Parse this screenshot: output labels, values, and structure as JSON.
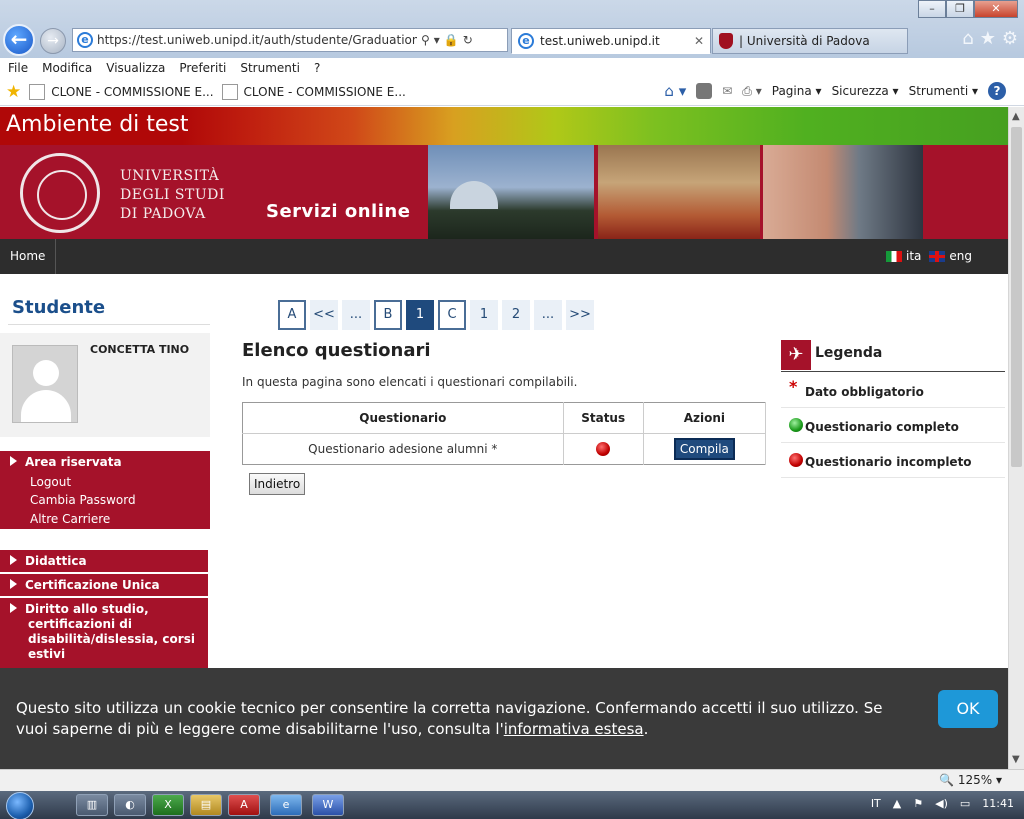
{
  "browser": {
    "url": "https://test.uniweb.unipd.it/auth/studente/Graduation/SceltaC",
    "tabs": [
      {
        "label": "test.uniweb.unipd.it"
      },
      {
        "label": "| Università di Padova"
      }
    ],
    "menu": [
      "File",
      "Modifica",
      "Visualizza",
      "Preferiti",
      "Strumenti",
      "?"
    ],
    "favorites": [
      "CLONE - COMMISSIONE E...",
      "CLONE - COMMISSIONE E..."
    ],
    "commands": [
      "Pagina",
      "Sicurezza",
      "Strumenti"
    ],
    "zoom": "125%"
  },
  "site": {
    "env_banner": "Ambiente di test",
    "uni_line1": "UNIVERSITÀ",
    "uni_line2": "DEGLI STUDI",
    "uni_line3": "DI PADOVA",
    "servizi": "Servizi online",
    "nav_home": "Home",
    "lang_it": "ita",
    "lang_en": "eng"
  },
  "sidebar": {
    "title": "Studente",
    "user_name": "CONCETTA TINO",
    "area_head": "Area riservata",
    "area_items": [
      "Logout",
      "Cambia Password",
      "Altre Carriere"
    ],
    "sections": [
      "Didattica",
      "Certificazione Unica",
      "Diritto allo studio, certificazioni di disabilità/dislessia, corsi estivi"
    ]
  },
  "pager": [
    "A",
    "<<",
    "...",
    "B",
    "1",
    "C",
    "1",
    "2",
    "...",
    ">>"
  ],
  "main": {
    "title": "Elenco questionari",
    "description": "In questa pagina sono elencati i questionari compilabili.",
    "table_headers": [
      "Questionario",
      "Status",
      "Azioni"
    ],
    "rows": [
      {
        "name": "Questionario adesione alumni *",
        "status": "incompleto",
        "action": "Compila"
      }
    ],
    "back_label": "Indietro"
  },
  "legend": {
    "title": "Legenda",
    "items": [
      "Dato obbligatorio",
      "Questionario completo",
      "Questionario incompleto"
    ]
  },
  "cookie": {
    "text": "Questo sito utilizza un cookie tecnico per consentire la corretta navigazione. Confermando accetti il suo utilizzo. Se vuoi saperne di più e leggere come disabilitarne l'uso, consulta l'",
    "link": "informativa estesa",
    "suffix": ".",
    "ok": "OK"
  },
  "taskbar": {
    "lang": "IT",
    "time": "11:41"
  },
  "colors": {
    "brand_red": "#a5122a",
    "nav_dark": "#2d2d2d",
    "title_blue": "#1b4f8b",
    "ok_blue": "#1e98d8"
  }
}
